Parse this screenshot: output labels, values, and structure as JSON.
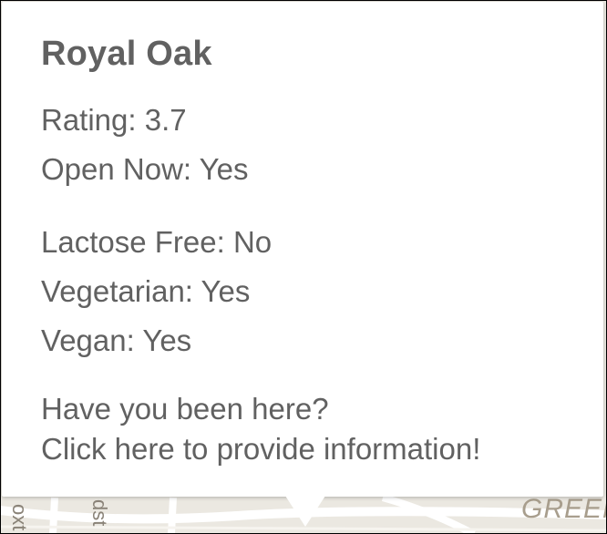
{
  "map": {
    "street_labels": [
      "oxt",
      "dst",
      "GREEN"
    ]
  },
  "info_window": {
    "title": "Royal Oak",
    "rating_line": "Rating: 3.7",
    "open_now_line": "Open Now: Yes",
    "lactose_free_line": "Lactose Free: No",
    "vegetarian_line": "Vegetarian: Yes",
    "vegan_line": "Vegan: Yes",
    "prompt_line": "Have you been here?",
    "link_line": "Click here to provide information!",
    "close_glyph": "×"
  }
}
